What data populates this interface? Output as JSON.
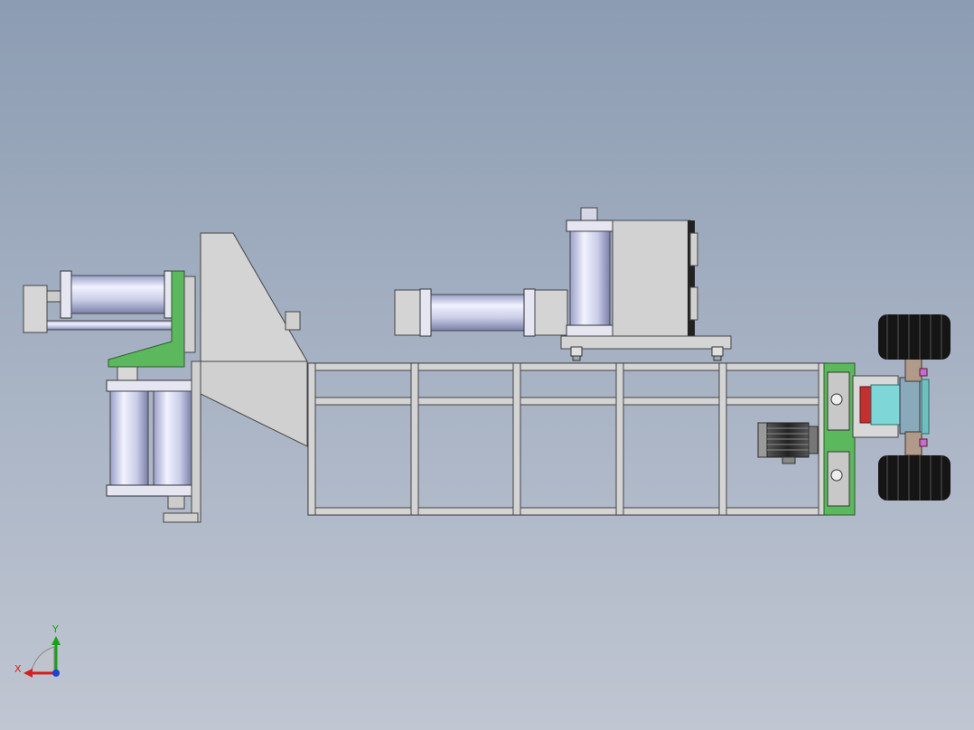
{
  "viewport": {
    "background_top": "#8c9cb2",
    "background_bottom": "#c0c6d2"
  },
  "colors": {
    "frame_steel": "#d0d0d0",
    "frame_edge": "#444444",
    "cylinder_highlight": "#f2f2ff",
    "cylinder_shade": "#7a7fa8",
    "bracket_green": "#5cb85c",
    "motor_dark": "#3a3a3a",
    "wheel_black": "#151515",
    "bearing_cyan": "#7fd6d6",
    "coupling_red": "#c23030",
    "accent_magenta": "#c86ad6"
  },
  "triad": {
    "x_label": "X",
    "y_label": "Y",
    "x_color": "#d42020",
    "y_color": "#1aa01a",
    "z_color": "#2040d0"
  }
}
